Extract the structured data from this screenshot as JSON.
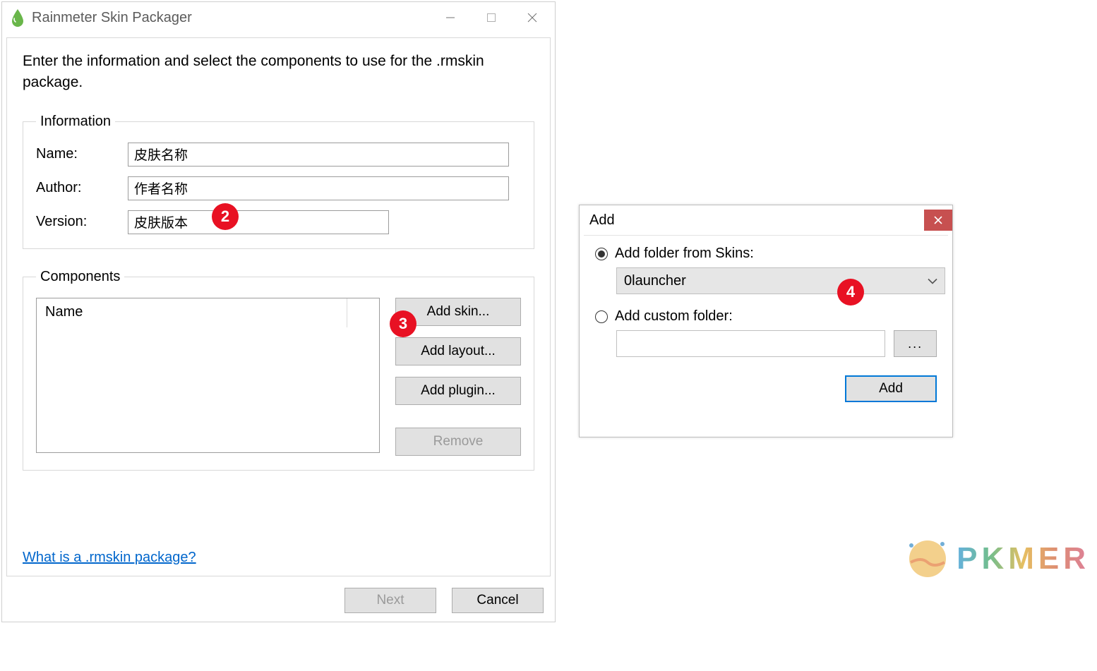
{
  "main": {
    "title": "Rainmeter Skin Packager",
    "instruction": "Enter the information and select the components to use for the .rmskin package.",
    "groups": {
      "info": {
        "legend": "Information",
        "name_label": "Name:",
        "name_value": "皮肤名称",
        "author_label": "Author:",
        "author_value": "作者名称",
        "version_label": "Version:",
        "version_value": "皮肤版本"
      },
      "components": {
        "legend": "Components",
        "column_header": "Name",
        "buttons": {
          "add_skin": "Add skin...",
          "add_layout": "Add layout...",
          "add_plugin": "Add plugin...",
          "remove": "Remove"
        }
      }
    },
    "help_link": "What is a .rmskin package?",
    "footer": {
      "next": "Next",
      "cancel": "Cancel"
    }
  },
  "add_dialog": {
    "title": "Add",
    "radio_folder_label": "Add folder from Skins:",
    "combo_value": "0launcher",
    "radio_custom_label": "Add custom folder:",
    "browse": "...",
    "add": "Add"
  },
  "badges": {
    "b2": "2",
    "b3": "3",
    "b4": "4"
  },
  "watermark": "PKMER"
}
